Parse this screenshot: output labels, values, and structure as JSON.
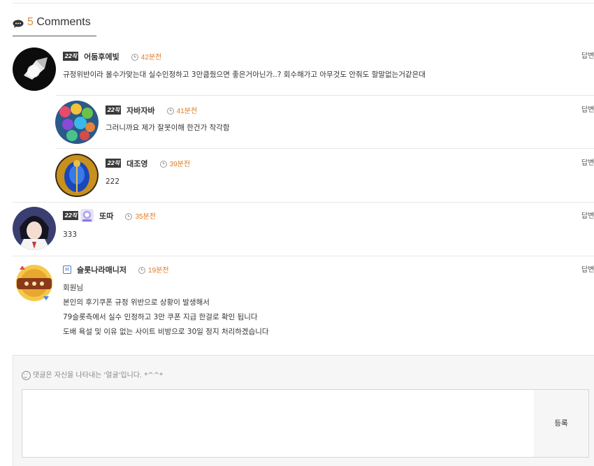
{
  "comments_header": {
    "count": "5",
    "label": "Comments"
  },
  "comments": [
    {
      "level_badge": "22직",
      "author": "어둠후에빛",
      "time": "42분전",
      "reply": "답변",
      "body": [
        "규정위반이라 몰수가맞는대 실수인정하고 3만쿱줬으면 좋은거아닌가..? 회수해가고 아무것도 안줘도 할말없는거같은대"
      ]
    },
    {
      "level_badge": "22직",
      "author": "자바자바",
      "time": "41분전",
      "reply": "답변",
      "body": [
        "그러니까요 제가 잘못이해 한건가 착각함"
      ]
    },
    {
      "level_badge": "22직",
      "author": "대조영",
      "time": "39분전",
      "reply": "답변",
      "body": [
        "222"
      ]
    },
    {
      "level_badge": "22직",
      "author": "또따",
      "time": "35분전",
      "reply": "답변",
      "body": [
        "333"
      ]
    },
    {
      "level_badge": "M",
      "author": "슬롯나라매니저",
      "time": "19분전",
      "reply": "답변",
      "body": [
        "회원님",
        "본인의 후기쿠폰 규정 위반으로 상황이 발생해서",
        "79슬롯측에서 실수 인정하고 3만 쿠폰 지급 한걸로 확인 됩니다",
        "도배 욕설 및 이유 없는 사이트 비방으로 30일 정지 처리하겠습니다"
      ]
    }
  ],
  "comment_form": {
    "hint": "댓글은 자신을 나타내는 '얼굴'입니다. *^^*",
    "submit_label": "등록"
  },
  "colors": {
    "time_accent": "#e07a1f",
    "count_accent": "#e08a3a"
  }
}
